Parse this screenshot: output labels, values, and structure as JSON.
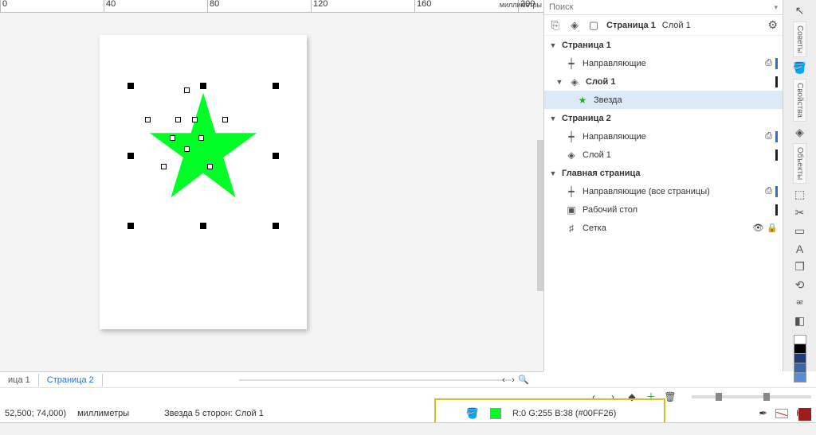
{
  "ruler": {
    "ticks": [
      0,
      40,
      80,
      120,
      160,
      200
    ],
    "units": "миллиметры"
  },
  "canvas": {
    "star_color": "#00FF26"
  },
  "doc_tabs": {
    "left": "ица 1",
    "tab2": "Страница 2"
  },
  "panel": {
    "search_placeholder": "Поиск",
    "crumb_page": "Страница 1",
    "crumb_layer": "Слой 1",
    "rows": [
      {
        "kind": "page",
        "label": "Страница 1"
      },
      {
        "kind": "guides",
        "label": "Направляющие"
      },
      {
        "kind": "layer",
        "label": "Слой 1"
      },
      {
        "kind": "obj",
        "label": "Звезда"
      },
      {
        "kind": "page",
        "label": "Страница 2"
      },
      {
        "kind": "guides",
        "label": "Направляющие"
      },
      {
        "kind": "layer2",
        "label": "Слой 1"
      },
      {
        "kind": "page",
        "label": "Главная страница"
      },
      {
        "kind": "guides",
        "label": "Направляющие (все страницы)"
      },
      {
        "kind": "desktop",
        "label": "Рабочий стол"
      },
      {
        "kind": "grid",
        "label": "Сетка"
      }
    ]
  },
  "sidebar": {
    "tabs": [
      "Советы",
      "Свойства",
      "Объекты"
    ]
  },
  "palette": [
    "#ffffff",
    "#000000",
    "#1e3c78",
    "#3a66aa",
    "#5b8bd4",
    "#8fb6ea",
    "#bcd6f4",
    "#e3eefb"
  ],
  "status": {
    "coords": "52,500; 74,000)",
    "coord_units": "миллиметры",
    "object_info": "Звезда  5 сторон: Слой 1",
    "fill_text": "R:0 G:255 B:38 (#00FF26)",
    "outline_text": "Нет"
  }
}
